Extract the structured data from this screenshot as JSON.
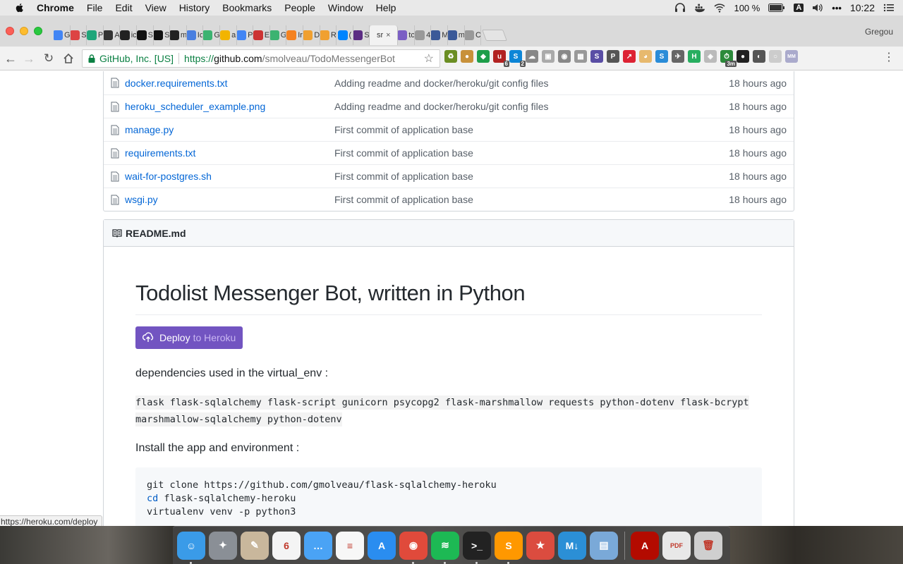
{
  "menubar": {
    "app_name": "Chrome",
    "items": [
      "File",
      "Edit",
      "View",
      "History",
      "Bookmarks",
      "People",
      "Window",
      "Help"
    ],
    "battery": "100 %",
    "input_source": "A",
    "clock": "10:22"
  },
  "tabs": {
    "items": [
      {
        "letter": "G",
        "color": "#4285f4"
      },
      {
        "letter": "S",
        "color": "#d44"
      },
      {
        "letter": "P",
        "color": "#1fa67a"
      },
      {
        "letter": "A",
        "color": "#333"
      },
      {
        "letter": "ic",
        "color": "#222"
      },
      {
        "letter": "S",
        "color": "#111"
      },
      {
        "letter": "S",
        "color": "#111"
      },
      {
        "letter": "m",
        "color": "#222"
      },
      {
        "letter": "Ic",
        "color": "#4a7fe0"
      },
      {
        "letter": "G",
        "color": "#3cb371"
      },
      {
        "letter": "a",
        "color": "#f2b400"
      },
      {
        "letter": "P",
        "color": "#4285f4"
      },
      {
        "letter": "E",
        "color": "#c33"
      },
      {
        "letter": "G",
        "color": "#3cb371"
      },
      {
        "letter": "Ir",
        "color": "#f58220"
      },
      {
        "letter": "D",
        "color": "#f0a030"
      },
      {
        "letter": "R",
        "color": "#f0a030"
      },
      {
        "letter": "(",
        "color": "#0084ff"
      },
      {
        "letter": "S",
        "color": "#5b2c83"
      }
    ],
    "active": {
      "label": "sr",
      "close": "×"
    },
    "after_active": [
      {
        "letter": "tc",
        "color": "#7b5fc4"
      },
      {
        "letter": "4",
        "color": "#999"
      },
      {
        "letter": "M",
        "color": "#3b5998"
      },
      {
        "letter": "m",
        "color": "#3b5998"
      },
      {
        "letter": "C",
        "color": "#999"
      }
    ],
    "profile": "Gregou"
  },
  "toolbar": {
    "security_label": "GitHub, Inc. [US]",
    "url_scheme": "https://",
    "url_host": "github.com",
    "url_path": "/smolveau/TodoMessengerBot",
    "extensions": [
      {
        "name": "recycle-icon",
        "color": "#6b8e23",
        "text": "♻"
      },
      {
        "name": "cookie-icon",
        "color": "#c8913a",
        "text": "●"
      },
      {
        "name": "shield-icon",
        "color": "#1e9e4a",
        "text": "◆"
      },
      {
        "name": "ublock-icon",
        "color": "#b22222",
        "text": "u",
        "badge": "6"
      },
      {
        "name": "skype-icon",
        "color": "#0d86d7",
        "text": "S",
        "badge": "2"
      },
      {
        "name": "cloud-icon",
        "color": "#888",
        "text": "☁"
      },
      {
        "name": "image-icon",
        "color": "#aaa",
        "text": "▣"
      },
      {
        "name": "camera-icon",
        "color": "#888",
        "text": "◉"
      },
      {
        "name": "grid-icon",
        "color": "#999",
        "text": "▦"
      },
      {
        "name": "s-icon",
        "color": "#5a4ea5",
        "text": "S"
      },
      {
        "name": "p-icon",
        "color": "#555",
        "text": "P"
      },
      {
        "name": "arrow-icon",
        "color": "#d23",
        "text": "↗"
      },
      {
        "name": "cat-icon",
        "color": "#e7b96e",
        "text": "◕"
      },
      {
        "name": "scribble-icon",
        "color": "#2a8cd8",
        "text": "S"
      },
      {
        "name": "bird-icon",
        "color": "#666",
        "text": "✈"
      },
      {
        "name": "h-icon",
        "color": "#27ae60",
        "text": "H"
      },
      {
        "name": "shield-grey-icon",
        "color": "#bbb",
        "text": "◈"
      },
      {
        "name": "timer-icon",
        "color": "#2c8a3b",
        "text": "⏱",
        "badge": "3m"
      },
      {
        "name": "github-icon",
        "color": "#222",
        "text": "●"
      },
      {
        "name": "pocket-icon",
        "color": "#555",
        "text": "◐"
      },
      {
        "name": "circle-icon",
        "color": "#ccc",
        "text": "○"
      },
      {
        "name": "mm-icon",
        "color": "#aac",
        "text": "MM"
      }
    ]
  },
  "files": [
    {
      "name": "docker.requirements.txt",
      "message": "Adding readme and docker/heroku/git config files",
      "age": "18 hours ago"
    },
    {
      "name": "heroku_scheduler_example.png",
      "message": "Adding readme and docker/heroku/git config files",
      "age": "18 hours ago"
    },
    {
      "name": "manage.py",
      "message": "First commit of application base",
      "age": "18 hours ago"
    },
    {
      "name": "requirements.txt",
      "message": "First commit of application base",
      "age": "18 hours ago"
    },
    {
      "name": "wait-for-postgres.sh",
      "message": "First commit of application base",
      "age": "18 hours ago"
    },
    {
      "name": "wsgi.py",
      "message": "First commit of application base",
      "age": "18 hours ago"
    }
  ],
  "readme": {
    "filename": "README.md",
    "title": "Todolist Messenger Bot, written in Python",
    "deploy_label_1": "Deploy",
    "deploy_label_2": "to Heroku",
    "deps_intro": "dependencies used in the virtual_env :",
    "deps_code": " flask flask-sqlalchemy flask-script gunicorn psycopg2 flask-marshmallow requests python-dotenv flask-bcrypt marshmallow-sqlalchemy python-dotenv ",
    "install_intro": "Install the app and environment :",
    "install_line_1": "git clone https://github.com/gmolveau/flask-sqlalchemy-heroku",
    "install_line_2_kw": "cd",
    "install_line_2_rest": " flask-sqlalchemy-heroku",
    "install_line_3": "virtualenv venv -p python3"
  },
  "status_url": "https://heroku.com/deploy",
  "dock": [
    {
      "name": "finder-icon",
      "color": "#3a9be8",
      "text": "☺",
      "running": true
    },
    {
      "name": "launchpad-icon",
      "color": "#8a8f96",
      "text": "✦",
      "running": false
    },
    {
      "name": "migration-icon",
      "color": "#c9b79c",
      "text": "✎",
      "running": false
    },
    {
      "name": "calendar-icon",
      "color": "#f4f4f4",
      "text": "6",
      "running": false
    },
    {
      "name": "messages-icon",
      "color": "#4aa3f5",
      "text": "…",
      "running": false
    },
    {
      "name": "reminders-icon",
      "color": "#f7f7f7",
      "text": "≡",
      "running": false
    },
    {
      "name": "app-store-icon",
      "color": "#2a8df0",
      "text": "A",
      "running": false
    },
    {
      "name": "chrome-icon",
      "color": "#e04a3b",
      "text": "◉",
      "running": true
    },
    {
      "name": "spotify-icon",
      "color": "#1db954",
      "text": "≋",
      "running": true
    },
    {
      "name": "terminal-icon",
      "color": "#222",
      "text": ">_",
      "running": true
    },
    {
      "name": "sublime-icon",
      "color": "#ff9800",
      "text": "S",
      "running": true
    },
    {
      "name": "wunderlist-icon",
      "color": "#db4c3f",
      "text": "★",
      "running": false
    },
    {
      "name": "markdown-icon",
      "color": "#2b8fd6",
      "text": "M↓",
      "running": false
    },
    {
      "name": "preview-icon",
      "color": "#7aa9d8",
      "text": "▤",
      "running": false
    },
    {
      "name": "acrobat-icon",
      "color": "#b30b00",
      "text": "A",
      "running": false
    },
    {
      "name": "pdf-file-icon",
      "color": "#e8e8e8",
      "text": "PDF",
      "running": false
    },
    {
      "name": "trash-icon",
      "color": "#cfcfcf",
      "text": "🗑",
      "running": false
    }
  ]
}
